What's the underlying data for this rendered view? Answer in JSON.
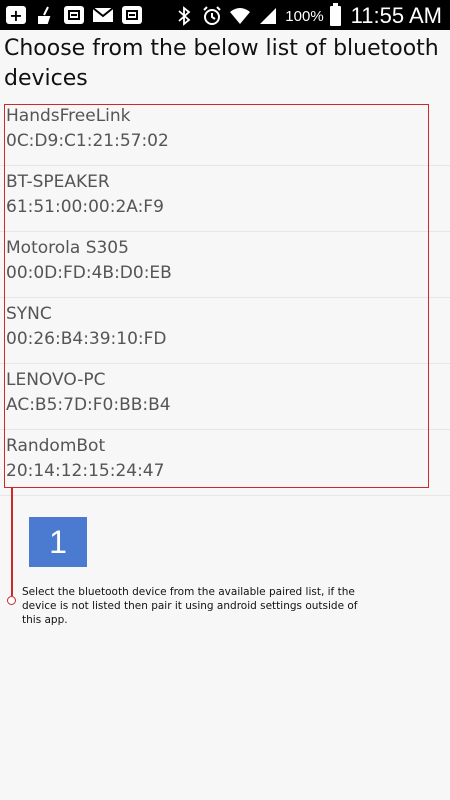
{
  "status_bar": {
    "left_icons": [
      "add-icon",
      "mop-icon",
      "app-icon",
      "mail-icon",
      "app-icon"
    ],
    "battery_percent": "100%",
    "time": "11:55 AM"
  },
  "title": "Choose from the below list of bluetooth devices",
  "devices": [
    {
      "name": "HandsFreeLink",
      "address": "0C:D9:C1:21:57:02"
    },
    {
      "name": "BT-SPEAKER",
      "address": "61:51:00:00:2A:F9"
    },
    {
      "name": "Motorola S305",
      "address": "00:0D:FD:4B:D0:EB"
    },
    {
      "name": "SYNC",
      "address": "00:26:B4:39:10:FD"
    },
    {
      "name": "LENOVO-PC",
      "address": "AC:B5:7D:F0:BB:B4"
    },
    {
      "name": "RandomBot",
      "address": "20:14:12:15:24:47"
    }
  ],
  "tutorial": {
    "step_number": "1",
    "hint": "Select the bluetooth device from the available paired list, if the device is not listed then pair it using android settings outside of this app.",
    "accent_color": "#cc2a2a",
    "badge_color": "#4a7bd0"
  }
}
